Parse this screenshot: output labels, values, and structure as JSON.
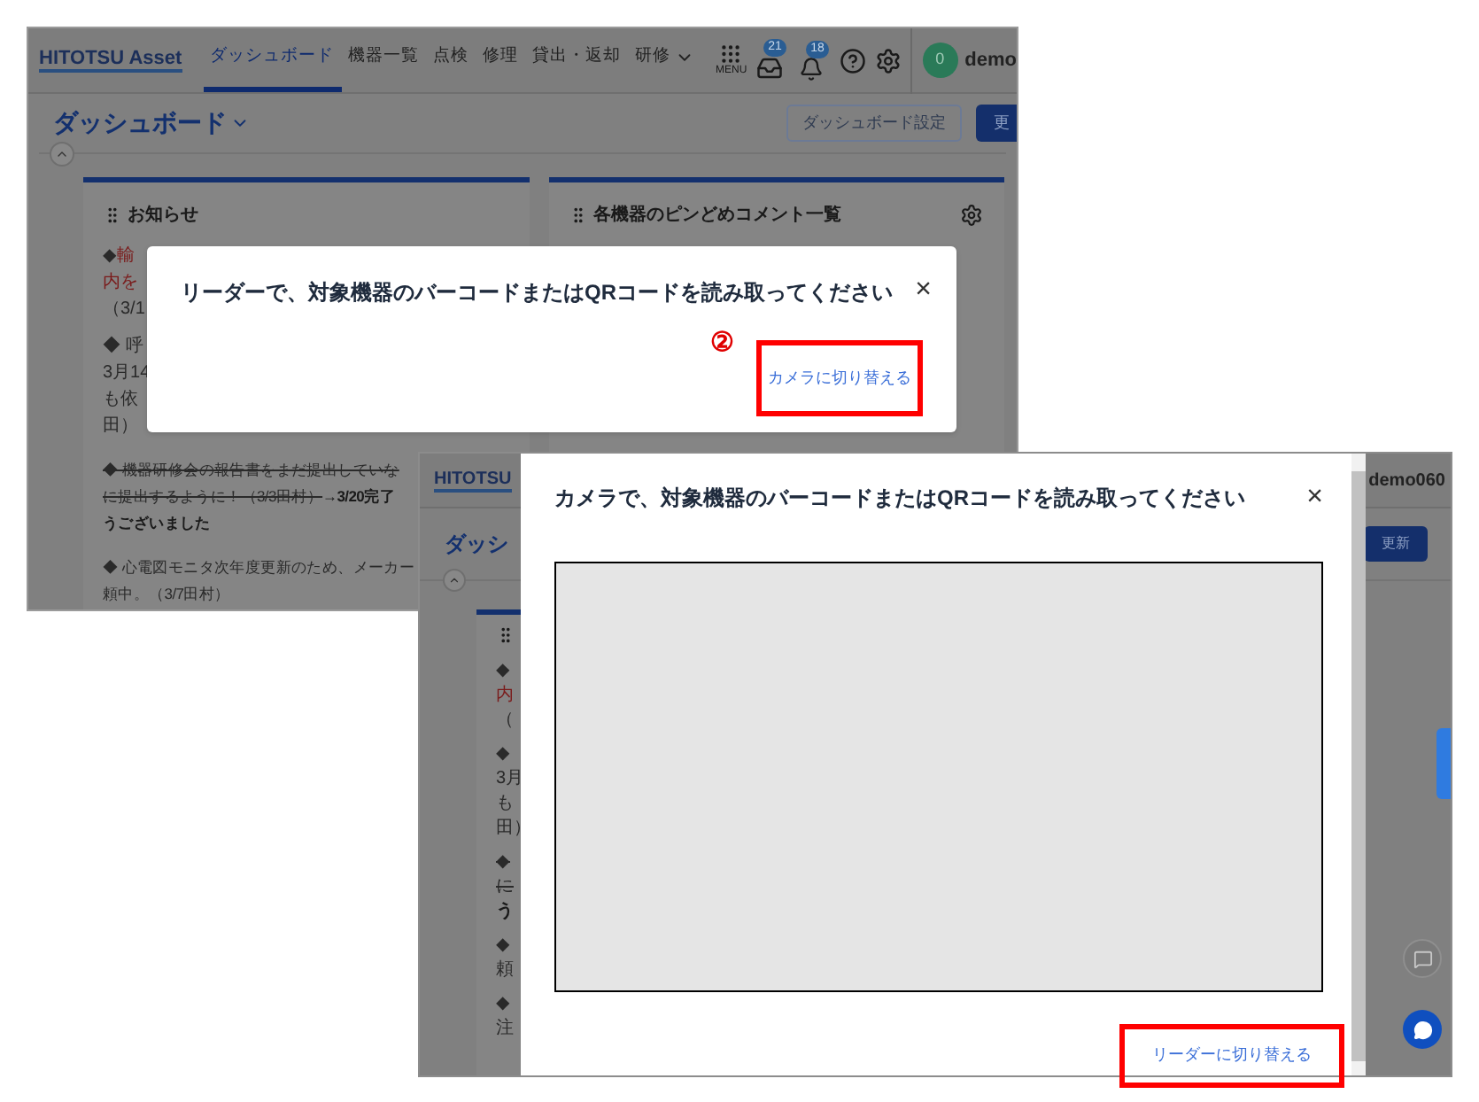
{
  "reader_screenshot": {
    "header": {
      "logo": "HITOTSU Asset",
      "nav": [
        {
          "label": "ダッシュボード",
          "selected": true
        },
        {
          "label": "機器一覧",
          "selected": false
        },
        {
          "label": "点検",
          "selected": false
        },
        {
          "label": "修理",
          "selected": false
        },
        {
          "label": "貸出・返却",
          "selected": false
        },
        {
          "label": "研修",
          "selected": false
        }
      ],
      "menu_label": "MENU",
      "inbox_badge": "21",
      "bell_badge": "18",
      "avatar": "0",
      "user": "demo"
    },
    "page_title": "ダッシュボード",
    "settings_button": "ダッシュボード設定",
    "update_button": "更",
    "notice_card": {
      "title": "お知らせ",
      "lines": [
        [
          {
            "text": "◆",
            "kind": "plain"
          },
          {
            "text": "輸",
            "kind": "red"
          }
        ],
        [
          {
            "text": "内を",
            "kind": "red"
          }
        ],
        [
          {
            "text": "（3/1",
            "kind": "plain"
          }
        ],
        [
          {
            "text": "◆ 呼",
            "kind": "plain"
          }
        ],
        [
          {
            "text": "3月14",
            "kind": "plain"
          }
        ],
        [
          {
            "text": "も依",
            "kind": "plain"
          }
        ],
        [
          {
            "text": "田）",
            "kind": "plain"
          }
        ],
        [
          {
            "text": "◆ 機器研修会の報告書をまだ提出していな",
            "kind": "strike"
          }
        ],
        [
          {
            "text": "に提出するように！（3/3田村）",
            "kind": "strike"
          },
          {
            "text": "→3/20完了",
            "kind": "bold"
          }
        ],
        [
          {
            "text": "うございました",
            "kind": "bold"
          }
        ],
        [
          {
            "text": "◆ 心電図モニタ次年度更新のため、メーカー",
            "kind": "plain"
          }
        ],
        [
          {
            "text": "頼中。（3/7田村）",
            "kind": "plain"
          }
        ]
      ]
    },
    "pinned_card": {
      "title": "各機器のピンどめコメント一覧"
    },
    "dialog": {
      "title": "リーダーで、対象機器のバーコードまたはQRコードを読み取ってください",
      "close": "×",
      "step": "②",
      "switch_link": "カメラに切り替える"
    }
  },
  "camera_screenshot": {
    "logo": "HITOTSU",
    "user": "demo060",
    "page_title": "ダッシ",
    "update_button": "更新",
    "card_lines": [
      [
        {
          "text": "◆",
          "kind": "plain"
        }
      ],
      [
        {
          "text": "内",
          "kind": "red"
        }
      ],
      [
        {
          "text": "（",
          "kind": "plain"
        }
      ],
      [
        {
          "text": "◆",
          "kind": "plain"
        }
      ],
      [
        {
          "text": "3月",
          "kind": "plain"
        }
      ],
      [
        {
          "text": "も",
          "kind": "plain"
        }
      ],
      [
        {
          "text": "田）",
          "kind": "plain"
        }
      ],
      [
        {
          "text": "◆",
          "kind": "strike"
        }
      ],
      [
        {
          "text": "に",
          "kind": "strike"
        }
      ],
      [
        {
          "text": "う",
          "kind": "bold"
        }
      ],
      [
        {
          "text": "◆",
          "kind": "plain"
        }
      ],
      [
        {
          "text": "頼",
          "kind": "plain"
        }
      ],
      [
        {
          "text": "◆",
          "kind": "plain"
        }
      ],
      [
        {
          "text": "注",
          "kind": "plain"
        }
      ]
    ],
    "dialog": {
      "title": "カメラで、対象機器のバーコードまたはQRコードを読み取ってください",
      "close": "×",
      "switch_link": "リーダーに切り替える"
    }
  }
}
